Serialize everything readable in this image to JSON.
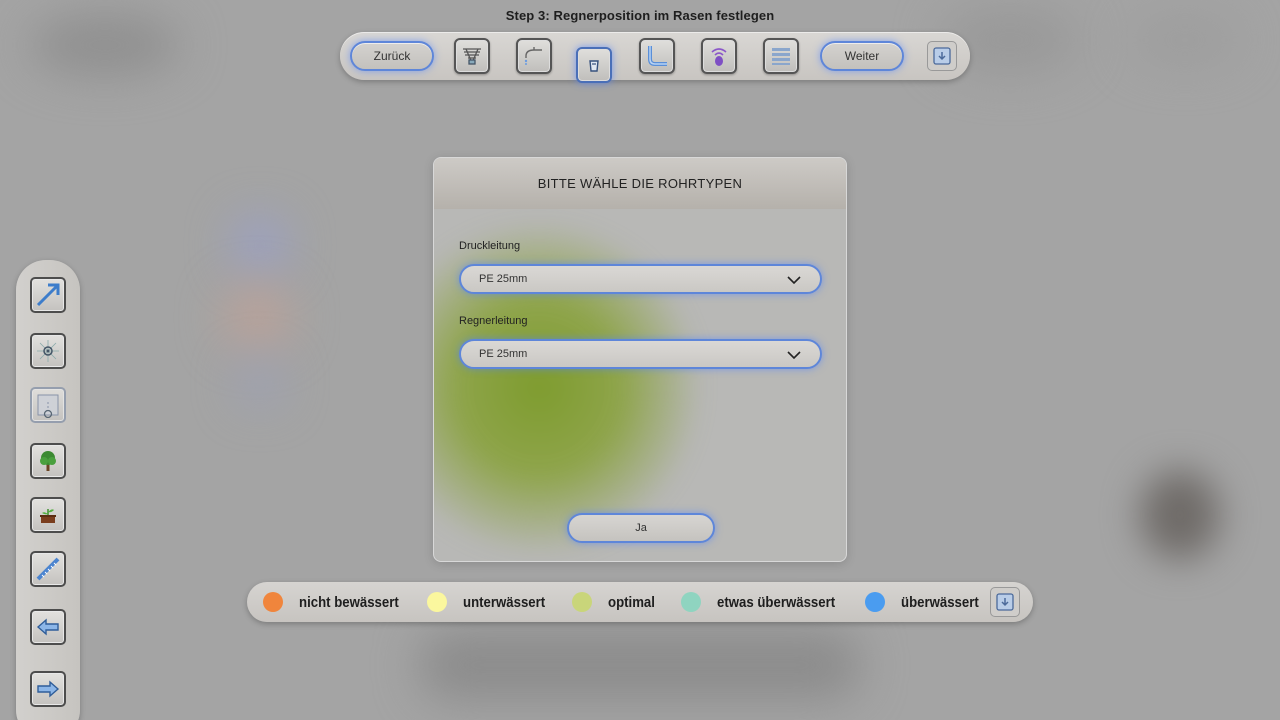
{
  "header": {
    "title": "Step 3: Regnerposition im Rasen festlegen"
  },
  "toolbar": {
    "back_label": "Zurück",
    "next_label": "Weiter",
    "icons": [
      "sprinkler-head-icon",
      "faucet-icon",
      "bucket-icon",
      "pipe-elbow-icon",
      "wifi-controller-icon",
      "list-icon",
      "collapse-icon"
    ]
  },
  "sidebar": {
    "items": [
      "arrow-tool-icon",
      "sprinkler-point-icon",
      "sprinkler-area-icon",
      "tree-icon",
      "plant-pot-icon",
      "measure-icon",
      "arrow-left-icon",
      "arrow-right-icon"
    ]
  },
  "dialog": {
    "title": "BITTE WÄHLE DIE ROHRTYPEN",
    "fields": [
      {
        "label": "Druckleitung",
        "value": "PE 25mm"
      },
      {
        "label": "Regnerleitung",
        "value": "PE 25mm"
      }
    ],
    "confirm_label": "Ja"
  },
  "legend": {
    "items": [
      {
        "label": "nicht bewässert",
        "color": "#f0853c"
      },
      {
        "label": "unterwässert",
        "color": "#fbf79e"
      },
      {
        "label": "optimal",
        "color": "#c9d57a"
      },
      {
        "label": "etwas überwässert",
        "color": "#8fd4c0"
      },
      {
        "label": "überwässert",
        "color": "#4a9cf0"
      }
    ]
  },
  "colors": {
    "accent_border": "#5e86d9",
    "toolbar_bg": "#d4d2cf",
    "backdrop": "#a4a4a4"
  }
}
